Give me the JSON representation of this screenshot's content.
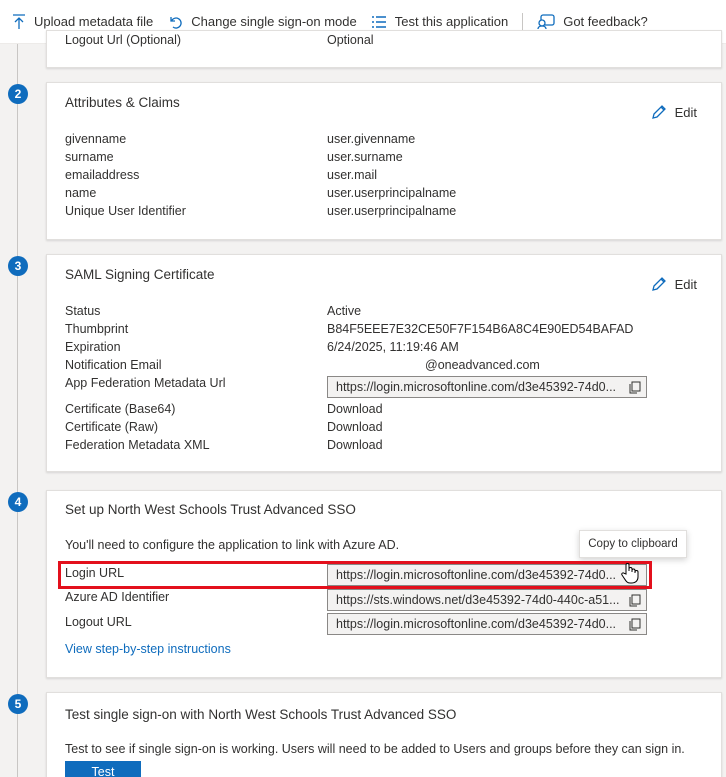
{
  "toolbar": {
    "upload": "Upload metadata file",
    "change_sso": "Change single sign-on mode",
    "test_app": "Test this application",
    "feedback": "Got feedback?"
  },
  "top_partial": {
    "key": "Logout Url (Optional)",
    "value": "Optional"
  },
  "steps": [
    "2",
    "3",
    "4",
    "5"
  ],
  "attributes": {
    "title": "Attributes & Claims",
    "edit": "Edit",
    "rows": [
      {
        "key": "givenname",
        "value": "user.givenname"
      },
      {
        "key": "surname",
        "value": "user.surname"
      },
      {
        "key": "emailaddress",
        "value": "user.mail"
      },
      {
        "key": "name",
        "value": "user.userprincipalname"
      },
      {
        "key": "Unique User Identifier",
        "value": "user.userprincipalname"
      }
    ]
  },
  "certificate": {
    "title": "SAML Signing Certificate",
    "edit": "Edit",
    "status_label": "Status",
    "status_value": "Active",
    "thumb_label": "Thumbprint",
    "thumb_value": "B84F5EEE7E32CE50F7F154B6A8C4E90ED54BAFAD",
    "exp_label": "Expiration",
    "exp_value": "6/24/2025, 11:19:46 AM",
    "notif_label": "Notification Email",
    "notif_value": "@oneadvanced.com",
    "fed_url_label": "App Federation Metadata Url",
    "fed_url_value": "https://login.microsoftonline.com/d3e45392-74d0...",
    "base64_label": "Certificate (Base64)",
    "base64_value": "Download",
    "raw_label": "Certificate (Raw)",
    "raw_value": "Download",
    "xml_label": "Federation Metadata XML",
    "xml_value": "Download"
  },
  "setup": {
    "title": "Set up North West Schools Trust Advanced SSO",
    "desc": "You'll need to configure the application to link with Azure AD.",
    "login_label": "Login URL",
    "login_value": "https://login.microsoftonline.com/d3e45392-74d0...",
    "identifier_label": "Azure AD Identifier",
    "identifier_value": "https://sts.windows.net/d3e45392-74d0-440c-a51...",
    "logout_label": "Logout URL",
    "logout_value": "https://login.microsoftonline.com/d3e45392-74d0...",
    "instructions": "View step-by-step instructions",
    "tooltip": "Copy to clipboard"
  },
  "test": {
    "title": "Test single sign-on with North West Schools Trust Advanced SSO",
    "desc": "Test to see if single sign-on is working. Users will need to be added to Users and groups before they can sign in.",
    "button": "Test"
  }
}
